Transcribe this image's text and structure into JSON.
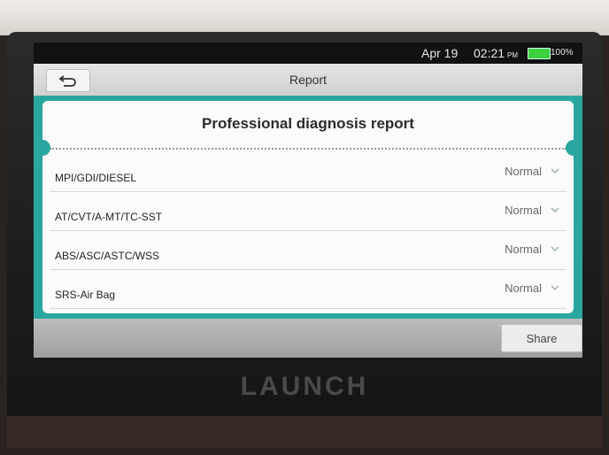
{
  "status": {
    "date": "Apr 19",
    "time": "02:21",
    "ampm": "PM",
    "battery": "100%",
    "battery_color": "#3fd03f"
  },
  "header": {
    "title": "Report",
    "back_icon": "back-arrow-icon"
  },
  "report": {
    "title": "Professional diagnosis report",
    "rows": [
      {
        "label": "MPI/GDI/DIESEL",
        "value": "Normal"
      },
      {
        "label": "AT/CVT/A-MT/TC-SST",
        "value": "Normal"
      },
      {
        "label": "ABS/ASC/ASTC/WSS",
        "value": "Normal"
      },
      {
        "label": "SRS-Air Bag",
        "value": "Normal"
      }
    ]
  },
  "footer": {
    "share_label": "Share"
  },
  "device": {
    "brand": "LAUNCH"
  },
  "colors": {
    "accent": "#2aa6a0"
  }
}
